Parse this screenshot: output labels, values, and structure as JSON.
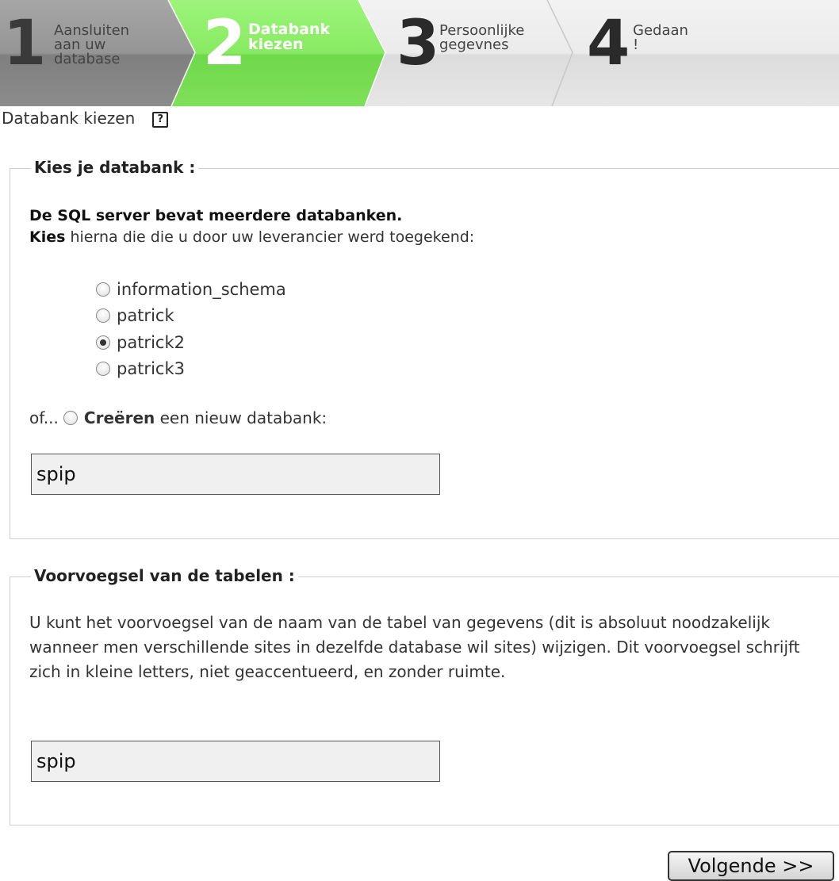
{
  "steps": [
    {
      "number": "1",
      "label": "Aansluiten\naan uw\ndatabase",
      "state": "done"
    },
    {
      "number": "2",
      "label": "Databank\nkiezen",
      "state": "active"
    },
    {
      "number": "3",
      "label": "Persoonlijke\ngegevnes",
      "state": "todo"
    },
    {
      "number": "4",
      "label": "Gedaan !",
      "state": "todo"
    }
  ],
  "page": {
    "subtitle": "Databank kiezen",
    "help_icon": "?"
  },
  "database_section": {
    "legend": "Kies je databank :",
    "server_note": "De SQL server bevat meerdere databanken.",
    "choose_bold": "Kies",
    "choose_rest": " hierna die die u door uw leverancier werd toegekend:",
    "databases": [
      "information_schema",
      "patrick",
      "patrick2",
      "patrick3"
    ],
    "selected": "patrick2",
    "or_prefix": "of...",
    "create_bold": "Creëren",
    "create_rest": " een nieuw databank:",
    "new_db_value": "spip"
  },
  "prefix_section": {
    "legend": "Voorvoegsel van de tabelen :",
    "description": "U kunt het voorvoegsel van de naam van de tabel van gegevens (dit is absoluut noodzakelijk wanneer men verschillende sites in dezelfde database wil sites) wijzigen. Dit voorvoegsel schrijft zich in kleine letters, niet geaccentueerd, en zonder ruimte.",
    "prefix_value": "spip"
  },
  "next_button": "Volgende >>",
  "colors": {
    "active_step": "#7ee05a",
    "done_step": "#8a8a8a",
    "todo_step": "#e8e8e8"
  }
}
